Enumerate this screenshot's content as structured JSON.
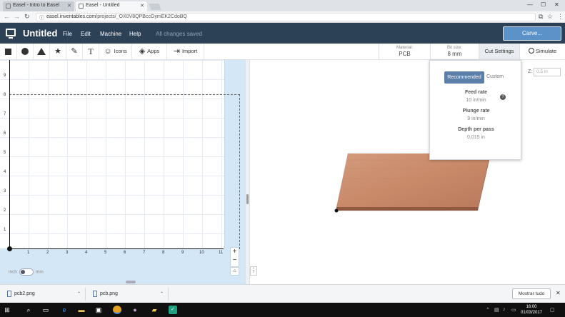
{
  "browser": {
    "tabs": [
      {
        "label": "Easel - Intro to Easel",
        "active": false
      },
      {
        "label": "Easel - Untitled",
        "active": true
      }
    ],
    "url_domain": "easel.inventables.com",
    "url_path": "/projects/_OX0V8QPBccGymEK2CdoBQ"
  },
  "header": {
    "title": "Untitled",
    "menu": [
      "File",
      "Edit",
      "Machine",
      "Help"
    ],
    "save_status": "All changes saved",
    "carve_label": "Carve..."
  },
  "toolbar": {
    "shape_tools": [
      "square-icon",
      "circle-icon",
      "triangle-icon",
      "star-icon",
      "pen-icon",
      "text-icon"
    ],
    "text_tool": "T",
    "icons_label": "Icons",
    "apps_label": "Apps",
    "import_label": "Import",
    "material_key": "Material:",
    "material_value": "PCB",
    "bitsize_key": "Bit size:",
    "bitsize_value": "8 mm",
    "cut_settings_label": "Cut Settings",
    "simulate_label": "Simulate"
  },
  "canvas": {
    "y_ticks": [
      "9",
      "8",
      "7",
      "6",
      "5",
      "4",
      "3",
      "2",
      "1"
    ],
    "x_ticks": [
      "1",
      "2",
      "3",
      "4",
      "5",
      "6",
      "7",
      "8",
      "9",
      "10",
      "11"
    ],
    "zoom_in": "+",
    "zoom_out": "−",
    "unit_inch": "inch",
    "unit_mm": "mm"
  },
  "preview": {
    "z_label": "Z:",
    "z_placeholder": "0.5 in",
    "material_color": "#c98a6a"
  },
  "cut_settings": {
    "recommended_label": "Recommended",
    "custom_label": "Custom",
    "feed_rate_label": "Feed rate",
    "feed_rate_value": "10 in/min",
    "plunge_rate_label": "Plunge rate",
    "plunge_rate_value": "9 in/min",
    "depth_label": "Depth per pass",
    "depth_value": "0.015 in"
  },
  "downloads": {
    "items": [
      "pcb2.png",
      "pcb.png"
    ],
    "show_all": "Mostrar tudo"
  },
  "taskbar": {
    "time": "16:00",
    "date": "01/03/2017"
  },
  "colors": {
    "header_bg": "#2c4156",
    "carve_button": "#5b92c7",
    "recommended_button": "#5b7fa8"
  }
}
